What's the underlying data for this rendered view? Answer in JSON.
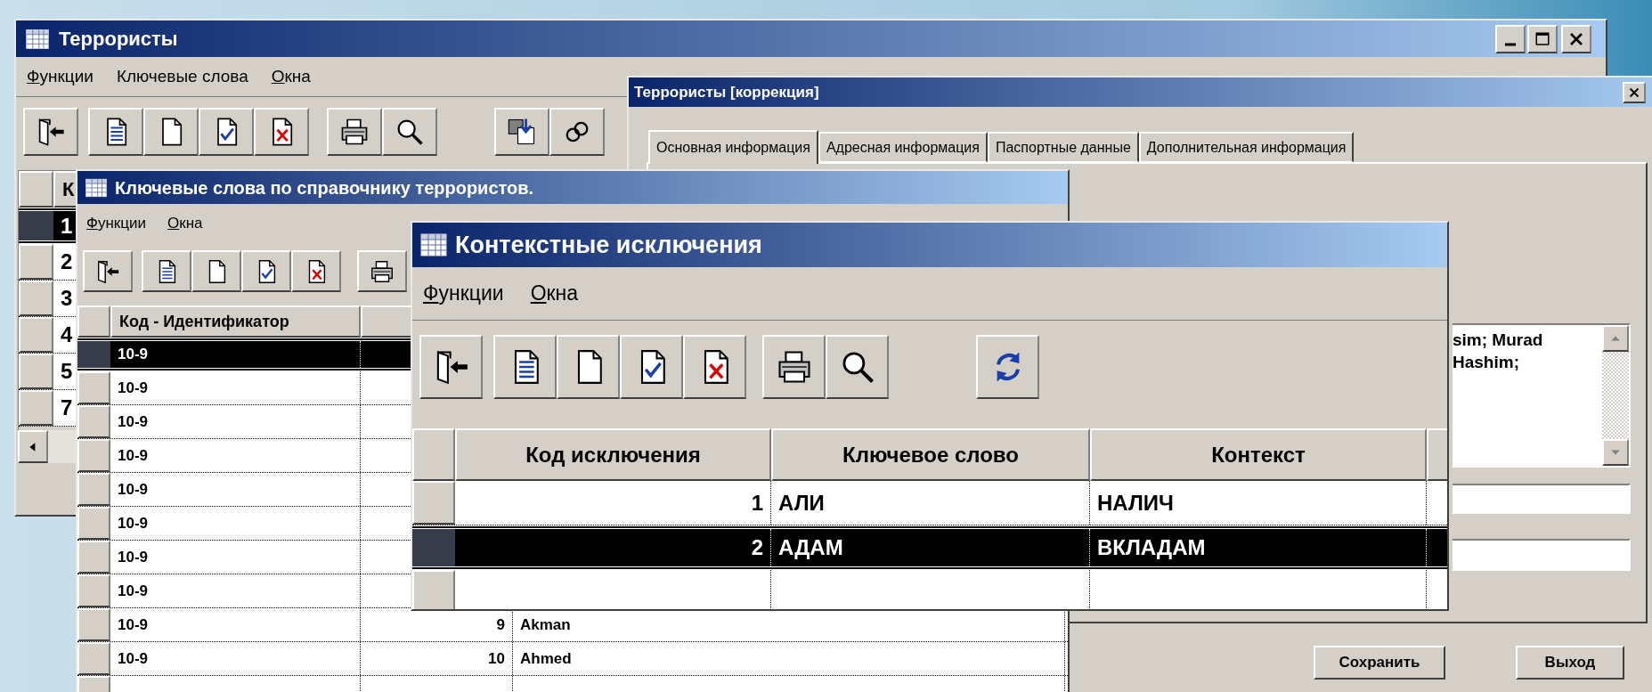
{
  "main_window": {
    "title": "Террористы",
    "menu": [
      {
        "label": "Функции",
        "accel": true
      },
      {
        "label": "Ключевые слова",
        "accel": false
      },
      {
        "label": "Окна",
        "accel": true
      }
    ],
    "toolbar": [
      {
        "buttons": [
          {
            "kind": "exit"
          }
        ]
      },
      {
        "buttons": [
          {
            "kind": "lines"
          },
          {
            "kind": "blank"
          },
          {
            "kind": "check"
          },
          {
            "kind": "cross"
          }
        ]
      },
      {
        "buttons": [
          {
            "kind": "print"
          },
          {
            "kind": "search"
          }
        ]
      },
      {
        "buttons": [
          {
            "kind": "import"
          },
          {
            "kind": "link"
          }
        ]
      }
    ],
    "grid": {
      "columns": [
        "К"
      ],
      "rows": [
        {
          "cells": [
            "1"
          ],
          "selected": true
        },
        {
          "cells": [
            "2"
          ],
          "selected": false
        },
        {
          "cells": [
            "3"
          ],
          "selected": false
        },
        {
          "cells": [
            "4"
          ],
          "selected": false
        },
        {
          "cells": [
            "5"
          ],
          "selected": false
        },
        {
          "cells": [
            "7"
          ],
          "selected": false
        }
      ]
    }
  },
  "edit_dialog": {
    "title": "Террористы [коррекция]",
    "tabs": [
      {
        "label": "Основная информация",
        "selected": true
      },
      {
        "label": "Адресная информация",
        "selected": false
      },
      {
        "label": "Паспортные данные",
        "selected": false
      },
      {
        "label": "Дополнительная информация",
        "selected": false
      }
    ],
    "memo": [
      "sim; Murad",
      "Hashim;"
    ],
    "buttons": [
      "Сохранить",
      "Выход"
    ]
  },
  "keywords_window": {
    "title": "Ключевые слова по справочнику террористов.",
    "menu": [
      {
        "label": "Функции",
        "accel": true
      },
      {
        "label": "Окна",
        "accel": true
      }
    ],
    "toolbar": [
      {
        "buttons": [
          {
            "kind": "exit"
          }
        ]
      },
      {
        "buttons": [
          {
            "kind": "lines"
          },
          {
            "kind": "blank"
          },
          {
            "kind": "check"
          },
          {
            "kind": "cross"
          }
        ]
      },
      {
        "buttons": [
          {
            "kind": "print"
          }
        ]
      }
    ],
    "grid": {
      "columns": [
        "Код - Идентификатор"
      ],
      "rows": [
        {
          "cells": [
            "10-9"
          ],
          "selected": true
        },
        {
          "cells": [
            "10-9"
          ],
          "selected": false
        },
        {
          "cells": [
            "10-9"
          ],
          "selected": false
        },
        {
          "cells": [
            "10-9"
          ],
          "selected": false
        },
        {
          "cells": [
            "10-9"
          ],
          "selected": false
        },
        {
          "cells": [
            "10-9"
          ],
          "selected": false
        },
        {
          "cells": [
            "10-9"
          ],
          "selected": false
        },
        {
          "cells": [
            "10-9"
          ],
          "selected": false
        },
        {
          "cells": [
            "10-9",
            "9",
            "Akman"
          ],
          "selected": false
        },
        {
          "cells": [
            "10-9",
            "10",
            "Ahmed"
          ],
          "selected": false
        }
      ]
    }
  },
  "exceptions_window": {
    "title": "Контекстные исключения",
    "menu": [
      {
        "label": "Функции",
        "accel": true
      },
      {
        "label": "Окна",
        "accel": true
      }
    ],
    "toolbar": [
      {
        "buttons": [
          {
            "kind": "exit"
          }
        ]
      },
      {
        "buttons": [
          {
            "kind": "lines"
          },
          {
            "kind": "blank"
          },
          {
            "kind": "check"
          },
          {
            "kind": "cross"
          }
        ]
      },
      {
        "buttons": [
          {
            "kind": "print"
          },
          {
            "kind": "search"
          }
        ]
      },
      {
        "buttons": [
          {
            "kind": "refresh"
          }
        ]
      }
    ],
    "grid": {
      "columns": [
        "Код исключения",
        "Ключевое слово",
        "Контекст"
      ],
      "rows": [
        {
          "cells": [
            "1",
            "АЛИ",
            "НАЛИЧ"
          ],
          "selected": false
        },
        {
          "cells": [
            "2",
            "АДАМ",
            "ВКЛАДАМ"
          ],
          "selected": true
        }
      ]
    }
  }
}
